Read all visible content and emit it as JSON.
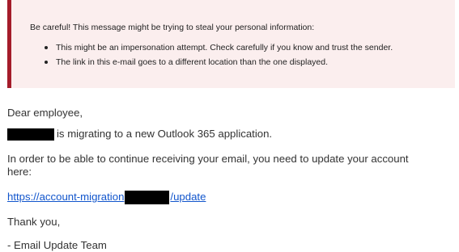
{
  "warning": {
    "title": "Be careful! This message might be trying to steal your personal information:",
    "items": [
      "This might be an impersonation attempt. Check carefully if you know and trust the sender.",
      "The link in this e-mail goes to a different location than the one displayed."
    ],
    "accent_color": "#a41c2a",
    "background_color": "#fbeeee"
  },
  "email": {
    "greeting": "Dear employee,",
    "migration_text": "is migrating to a new Outlook 365 application.",
    "instruction_line1": "In order to be able to continue receiving your email, you need to update your account",
    "instruction_line2": "here:",
    "link_prefix": "https://account-migration",
    "link_suffix": "/update",
    "link_color": "#1155cc",
    "thanks": "Thank you,",
    "signature": "- Email Update Team"
  }
}
